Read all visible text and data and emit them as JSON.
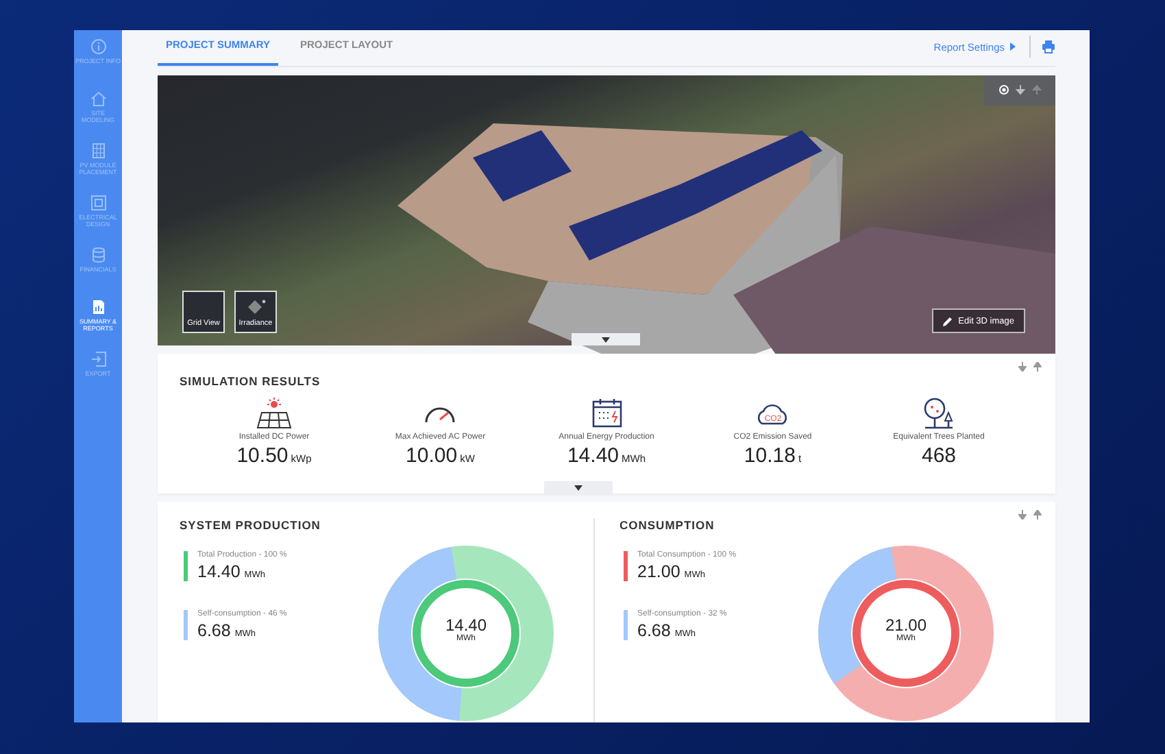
{
  "sidebar": {
    "items": [
      {
        "label": "PROJECT INFO",
        "selected": false
      },
      {
        "label": "SITE MODELING",
        "selected": false
      },
      {
        "label": "PV MODULE PLACEMENT",
        "selected": false
      },
      {
        "label": "ELECTRICAL DESIGN",
        "selected": false
      },
      {
        "label": "FINANCIALS",
        "selected": false
      },
      {
        "label": "SUMMARY & REPORTS",
        "selected": true
      },
      {
        "label": "EXPORT",
        "selected": false
      }
    ]
  },
  "tabs": [
    {
      "label": "PROJECT SUMMARY",
      "selected": true
    },
    {
      "label": "PROJECT LAYOUT",
      "selected": false
    }
  ],
  "report_settings": "Report Settings",
  "viewer": {
    "view_buttons": [
      {
        "label": "Grid View",
        "kind": "grid"
      },
      {
        "label": "Irradiance",
        "kind": "irradiance"
      }
    ],
    "edit_button": "Edit 3D image"
  },
  "simulation_results": {
    "title": "SIMULATION RESULTS",
    "metrics": [
      {
        "kind": "solar",
        "label": "Installed DC Power",
        "value": "10.50",
        "unit": "kWp"
      },
      {
        "kind": "gauge",
        "label": "Max Achieved AC Power",
        "value": "10.00",
        "unit": "kW"
      },
      {
        "kind": "calendar",
        "label": "Annual Energy Production",
        "value": "14.40",
        "unit": "MWh"
      },
      {
        "kind": "co2",
        "icon_text": "CO2",
        "label": "CO2 Emission Saved",
        "value": "10.18",
        "unit": "t"
      },
      {
        "kind": "trees",
        "label": "Equivalent Trees Planted",
        "value": "468"
      }
    ]
  },
  "energy": [
    {
      "title": "SYSTEM PRODUCTION",
      "color": "#4cc97a",
      "stats": [
        {
          "label": "Total Production - 100 %",
          "value": "14.40",
          "unit": "MWh",
          "color": "#4cc97a"
        },
        {
          "label": "Self-consumption - 46 %",
          "value": "6.68",
          "unit": "MWh",
          "color": "#a3c8fb"
        }
      ],
      "donut": {
        "level": 0.46,
        "value": "14.40",
        "unit": "MWh"
      }
    },
    {
      "title": "CONSUMPTION",
      "color": "#ee5d5d",
      "stats": [
        {
          "label": "Total Consumption - 100 %",
          "value": "21.00",
          "unit": "MWh",
          "color": "#ee5d5d"
        },
        {
          "label": "Self-consumption - 32 %",
          "value": "6.68",
          "unit": "MWh",
          "color": "#a3c8fb"
        }
      ],
      "donut": {
        "level": 0.32,
        "value": "21.00",
        "unit": "MWh"
      }
    }
  ]
}
